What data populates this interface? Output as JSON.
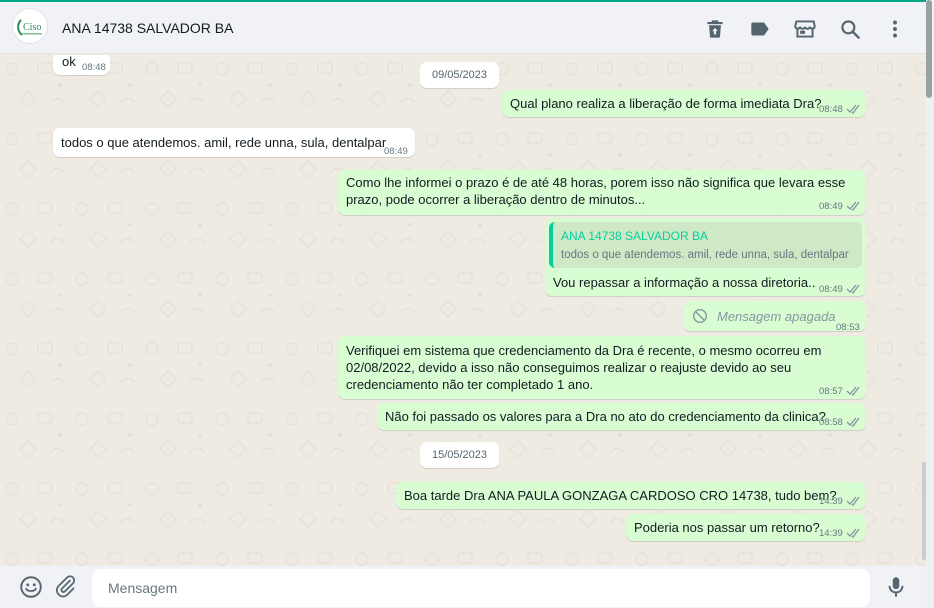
{
  "header": {
    "contact_name": "ANA 14738 SALVADOR BA",
    "avatar_text": "Ciso",
    "icons": [
      "delete-icon",
      "label-icon",
      "store-icon",
      "search-icon",
      "menu-dots-icon"
    ]
  },
  "colors": {
    "accent": "#00a884",
    "incoming_bubble": "#ffffff",
    "outgoing_bubble": "#d9fdd3",
    "chat_background": "#efeae2",
    "read_ticks": "#8696a0",
    "quote_author": "#06cf9c"
  },
  "messages": [
    {
      "dir": "in",
      "text": "ok",
      "time": "08:48"
    },
    {
      "type": "date",
      "text": "09/05/2023"
    },
    {
      "dir": "out",
      "text": "Qual plano realiza a liberação de forma imediata Dra?",
      "time": "08:48",
      "status": "read"
    },
    {
      "dir": "in",
      "text": "todos o que atendemos. amil, rede unna, sula, dentalpar",
      "time": "08:49"
    },
    {
      "dir": "out",
      "lines": [
        "Como lhe informei o prazo é de até 48 horas, porem isso não significa que levara esse",
        "prazo, pode ocorrer a liberação dentro de minutos..."
      ],
      "time": "08:49",
      "status": "read"
    },
    {
      "dir": "out",
      "quote": {
        "author": "ANA 14738 SALVADOR BA",
        "text": "todos o que atendemos. amil, rede unna, sula, dentalpar"
      },
      "text": "Vou repassar a informação a nossa diretoria..",
      "time": "08:49",
      "status": "read"
    },
    {
      "dir": "out",
      "deleted": true,
      "text": "Mensagem apagada",
      "time": "08:53"
    },
    {
      "dir": "out",
      "lines": [
        "Verifiquei em sistema que credenciamento da Dra é recente, o mesmo ocorreu em",
        "02/08/2022, devido a isso não conseguimos realizar o reajuste devido ao seu",
        "credenciamento não ter completado 1 ano."
      ],
      "time": "08:57",
      "status": "read"
    },
    {
      "dir": "out",
      "text": "Não foi passado os valores para a Dra no ato do credenciamento da clinica?",
      "time": "08:58",
      "status": "read"
    },
    {
      "type": "date",
      "text": "15/05/2023"
    },
    {
      "dir": "out",
      "text": "Boa tarde Dra ANA PAULA GONZAGA CARDOSO CRO 14738, tudo bem?",
      "time": "14:39",
      "status": "read"
    },
    {
      "dir": "out",
      "text": "Poderia nos passar um retorno?",
      "time": "14:39",
      "status": "read"
    }
  ],
  "composer": {
    "placeholder": "Mensagem",
    "icons": [
      "emoji-icon",
      "attach-icon",
      "microphone-icon"
    ]
  }
}
